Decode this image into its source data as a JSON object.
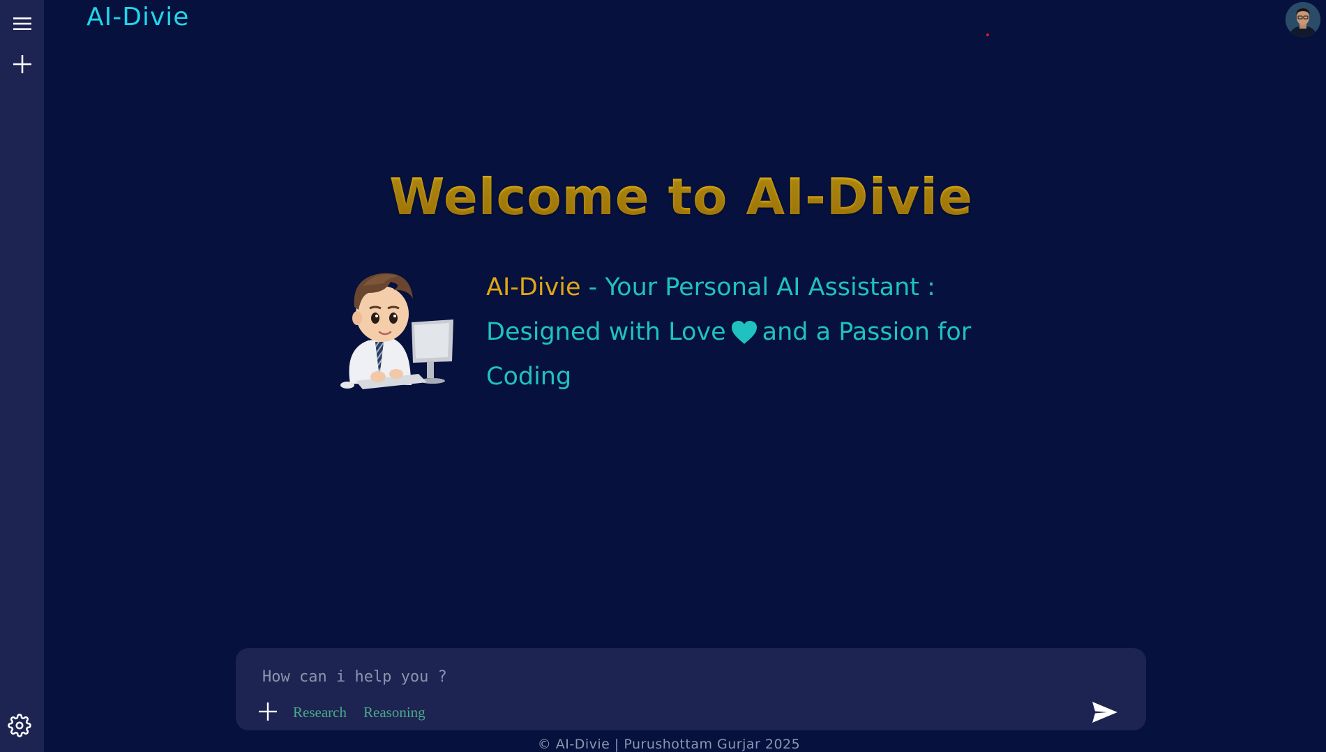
{
  "app": {
    "title": "AI-Divie"
  },
  "sidebar": {
    "menu_icon": "hamburger-menu-icon",
    "new_chat_icon": "plus-icon",
    "settings_icon": "gear-icon"
  },
  "header": {
    "avatar_icon": "user-avatar"
  },
  "welcome": {
    "heading": "Welcome to AI-Divie",
    "brand": "AI-Divie",
    "tagline_line1_rest": " - Your Personal AI Assistant :",
    "tagline_line2_start": "Designed with Love",
    "heart_icon": "heart-icon",
    "tagline_line2_end": "and a Passion for",
    "tagline_line3": "Coding",
    "mascot_icon": "developer-mascot-illustration"
  },
  "composer": {
    "placeholder": "How can i help you ?",
    "value": "",
    "attach_icon": "plus-icon",
    "chips": [
      "Research",
      "Reasoning"
    ],
    "send_icon": "send-arrow-icon"
  },
  "footer": {
    "text": "© AI-Divie | Purushottam Gurjar 2025"
  },
  "colors": {
    "background": "#06113d",
    "sidebar": "#1d2452",
    "accent_cyan": "#1fd6ea",
    "teal": "#1fc2c0",
    "gold": "#e0a712",
    "chip_green": "#4ca88a"
  }
}
